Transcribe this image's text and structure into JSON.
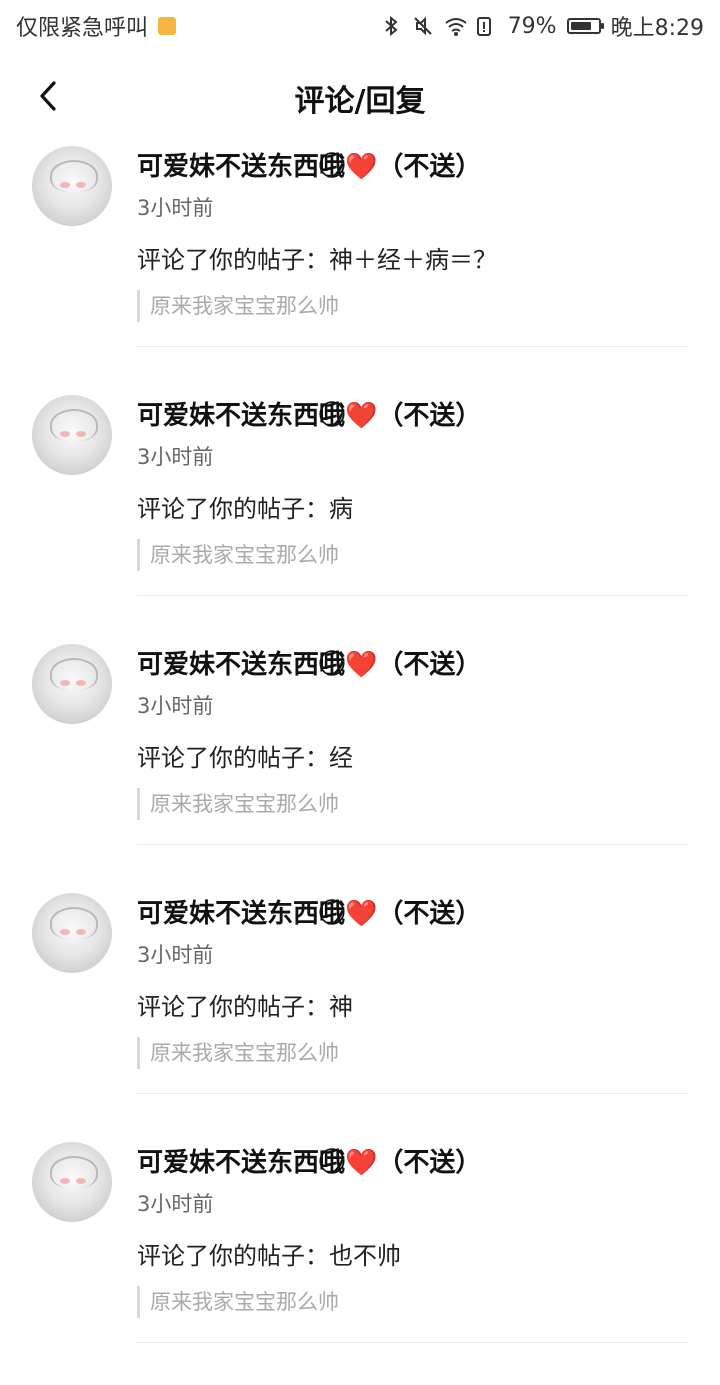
{
  "status_bar": {
    "left_text": "仅限紧急呼叫",
    "battery_percent_text": "79%",
    "battery_level": 0.79,
    "time": "晚上8:29",
    "icons": [
      "bluetooth-icon",
      "mute-icon",
      "wifi-icon",
      "battery-alert-icon",
      "battery-icon"
    ]
  },
  "header": {
    "back_icon": "chevron-left-icon",
    "title": "评论/回复"
  },
  "items": [
    {
      "username": "可爱妹不送东西哦⃝❤️（不送）",
      "time": "3小时前",
      "comment": "评论了你的帖子：神＋经＋病＝？",
      "quote": "原来我家宝宝那么帅"
    },
    {
      "username": "可爱妹不送东西哦⃝❤️（不送）",
      "time": "3小时前",
      "comment": "评论了你的帖子：病",
      "quote": "原来我家宝宝那么帅"
    },
    {
      "username": "可爱妹不送东西哦⃝❤️（不送）",
      "time": "3小时前",
      "comment": "评论了你的帖子：经",
      "quote": "原来我家宝宝那么帅"
    },
    {
      "username": "可爱妹不送东西哦⃝❤️（不送）",
      "time": "3小时前",
      "comment": "评论了你的帖子：神",
      "quote": "原来我家宝宝那么帅"
    },
    {
      "username": "可爱妹不送东西哦⃝❤️（不送）",
      "time": "3小时前",
      "comment": "评论了你的帖子：也不帅",
      "quote": "原来我家宝宝那么帅"
    }
  ]
}
